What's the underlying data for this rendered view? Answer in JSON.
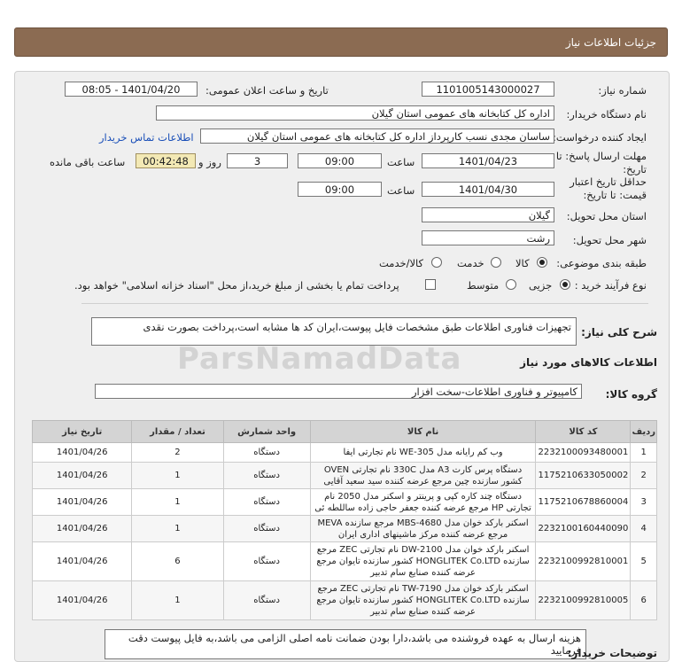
{
  "header": {
    "title": "جزئیات اطلاعات نیاز"
  },
  "fields": {
    "need_number_label": "شماره نیاز:",
    "need_number": "1101005143000027",
    "announce_label": "تاریخ و ساعت اعلان عمومی:",
    "announce_value": "1401/04/20 - 08:05",
    "buyer_org_label": "نام دستگاه خریدار:",
    "buyer_org": "اداره کل کتابخانه های عمومی استان گیلان",
    "creator_label": "ایجاد کننده درخواست:",
    "creator": "ساسان مجدی نسب کارپرداز اداره کل کتابخانه های عمومی استان گیلان",
    "contact_link": "اطلاعات تماس خریدار",
    "deadline_label_1": "مهلت ارسال پاسخ: تا",
    "deadline_label_2": "تاریخ:",
    "deadline_date": "1401/04/23",
    "time_label": "ساعت",
    "deadline_time": "09:00",
    "days_value": "3",
    "days_label": "روز و",
    "remaining_value": "00:42:48",
    "remaining_label": "ساعت باقی مانده",
    "validity_label_1": "حداقل تاریخ اعتبار",
    "validity_label_2": "قیمت: تا تاریخ:",
    "validity_date": "1401/04/30",
    "validity_time": "09:00",
    "province_label": "استان محل تحویل:",
    "province": "گیلان",
    "city_label": "شهر محل تحویل:",
    "city": "رشت",
    "category_label": "طبقه بندی موضوعی:",
    "category_options": [
      "کالا",
      "خدمت",
      "کالا/خدمت"
    ],
    "process_label": "نوع فرآیند خرید :",
    "process_options": [
      "جزیی",
      "متوسط"
    ],
    "payment_note": "پرداخت تمام یا بخشی از مبلغ خرید،از محل \"اسناد خزانه اسلامی\" خواهد بود."
  },
  "summary": {
    "label": "شرح کلی نیاز:",
    "text": "تجهیزات فناوری اطلاعات طبق مشخصات فایل پیوست،ایران کد ها مشابه است،پرداخت بصورت نقدی"
  },
  "goods": {
    "section_title": "اطلاعات کالاهای مورد نیاز",
    "group_label": "گروه کالا:",
    "group_value": "کامپیوتر و فناوری اطلاعات-سخت افزار"
  },
  "table": {
    "headers": [
      "ردیف",
      "کد کالا",
      "نام کالا",
      "واحد شمارش",
      "تعداد / مقدار",
      "تاریخ نیاز"
    ],
    "rows": [
      [
        "1",
        "2232100093480001",
        "وب کم رایانه مدل WE-305 نام تجارتی ایفا",
        "دستگاه",
        "2",
        "1401/04/26"
      ],
      [
        "2",
        "1175210633050002",
        "دستگاه پرس کارت A3 مدل 330C نام تجارتی OVEN کشور سازنده چین مرجع عرضه کننده سید سعید آقایی",
        "دستگاه",
        "1",
        "1401/04/26"
      ],
      [
        "3",
        "1175210678860004",
        "دستگاه چند کاره کپی و پرینتر و اسکنر مدل 2050 نام تجارتی HP مرجع عرضه کننده جعفر حاجی زاده ساللطه ئی",
        "دستگاه",
        "1",
        "1401/04/26"
      ],
      [
        "4",
        "2232100160440090",
        "اسکنر بارکد خوان مدل MBS-4680 مرجع سازنده MEVA مرجع عرضه کننده مرکز ماشینهای اداری ایران",
        "دستگاه",
        "1",
        "1401/04/26"
      ],
      [
        "5",
        "2232100992810001",
        "اسکنر بارکد خوان مدل DW-2100 نام تجارتی ZEC مرجع سازنده HONGLITEK Co.LTD کشور سازنده تایوان مرجع عرضه کننده صنایع سام تدبیر",
        "دستگاه",
        "6",
        "1401/04/26"
      ],
      [
        "6",
        "2232100992810005",
        "اسکنر بارکد خوان مدل TW-7190 نام تجارتی ZEC مرجع سازنده HONGLITEK Co.LTD کشور سازنده تایوان مرجع عرضه کننده صنایع سام تدبیر",
        "دستگاه",
        "1",
        "1401/04/26"
      ]
    ]
  },
  "buyer_notes": {
    "label": "توضیحات خریدار:",
    "text": "هزینه ارسال به عهده فروشنده می باشد،دارا بودن ضمانت نامه اصلی الزامی می باشد،به فایل پیوست دقت فرمایید"
  },
  "watermark": "ParsNamadData"
}
